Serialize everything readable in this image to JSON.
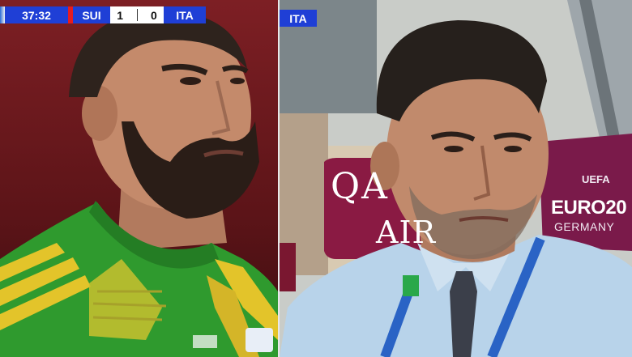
{
  "scorebug": {
    "time": "37:32",
    "home_team": "SUI",
    "home_score": "1",
    "away_score": "0",
    "away_team": "ITA",
    "team_color": "#1f3fd6",
    "accent_red": "#e51c23"
  },
  "right_panel": {
    "team_tag": "ITA",
    "sponsor_line1": "QA",
    "sponsor_line2": "AIR",
    "tournament_uefa": "UEFA",
    "tournament_name": "EURO20",
    "tournament_country": "GERMANY"
  },
  "left_subject": {
    "jersey_color": "#2f9a2e"
  },
  "right_subject": {
    "shirt_color": "#b8d3ea"
  }
}
